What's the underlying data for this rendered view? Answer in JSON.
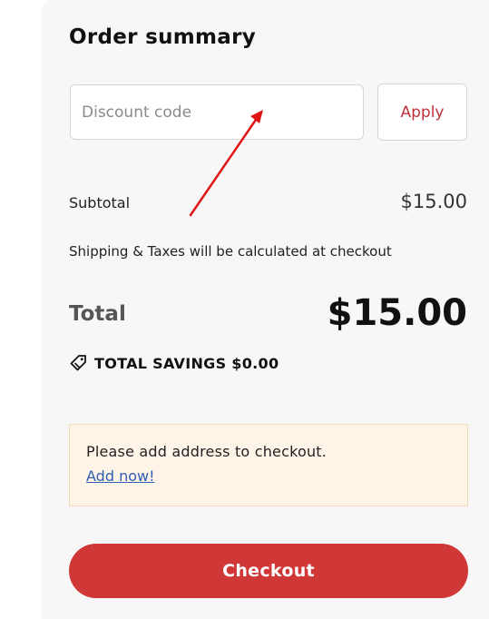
{
  "order_summary": {
    "title": "Order summary",
    "discount": {
      "placeholder": "Discount code",
      "value": "",
      "apply_label": "Apply"
    },
    "subtotal": {
      "label": "Subtotal",
      "value": "$15.00"
    },
    "shipping_note": "Shipping & Taxes will be calculated at checkout",
    "total": {
      "label": "Total",
      "value": "$15.00"
    },
    "savings": {
      "icon": "tag-icon",
      "text": "TOTAL SAVINGS $0.00"
    },
    "notice": {
      "message": "Please add address to checkout.",
      "link_label": "Add now!"
    },
    "checkout_label": "Checkout"
  },
  "colors": {
    "panel_bg": "#f7f7f7",
    "accent_red": "#d03838",
    "apply_text": "#c0323a",
    "notice_bg": "#fff4e8",
    "notice_border": "#f2d9b8",
    "link_blue": "#2f5fb3",
    "annotation_arrow": "#e01414"
  },
  "annotation": {
    "type": "arrow",
    "points_to": "discount-code-input"
  }
}
